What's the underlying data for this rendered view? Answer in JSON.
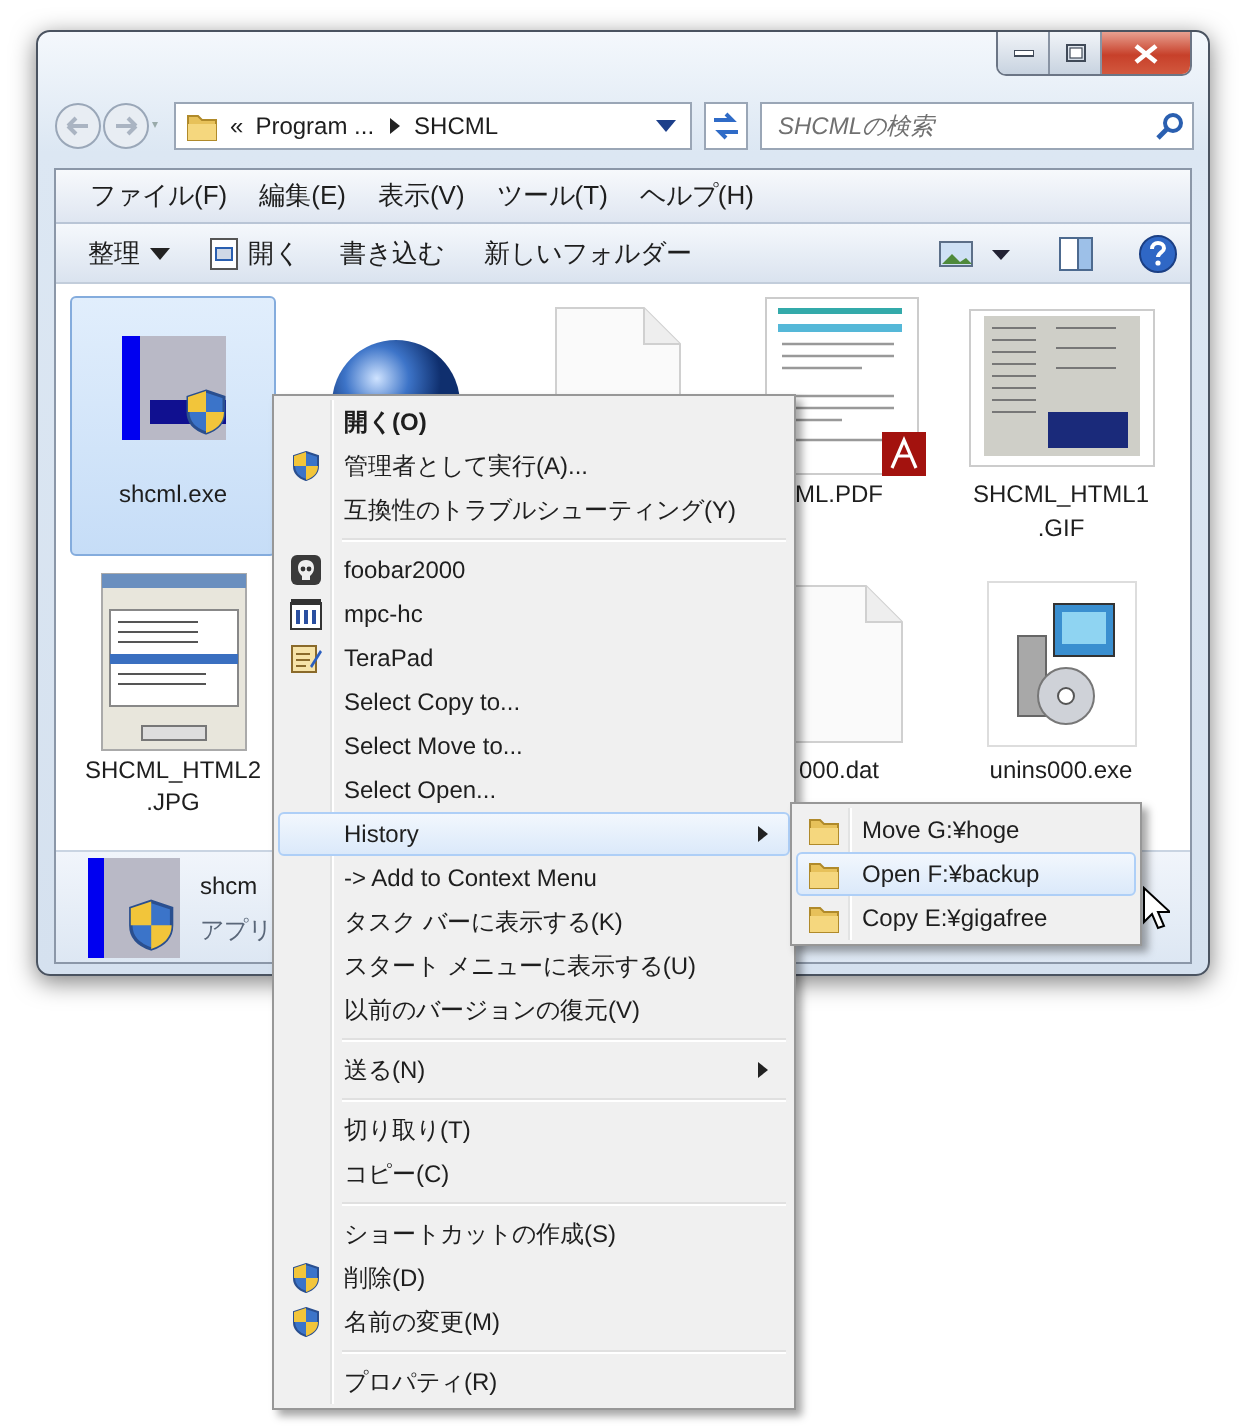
{
  "address_bar": {
    "overflow": "«",
    "path": [
      "Program ...",
      "SHCML"
    ]
  },
  "search": {
    "placeholder": "SHCMLの検索"
  },
  "menu_bar": [
    "ファイル(F)",
    "編集(E)",
    "表示(V)",
    "ツール(T)",
    "ヘルプ(H)"
  ],
  "toolbar": [
    {
      "label": "整理",
      "kind": "dropdown"
    },
    {
      "label": "開く",
      "kind": "open"
    },
    {
      "label": "書き込む",
      "kind": "plain"
    },
    {
      "label": "新しいフォルダー",
      "kind": "plain"
    }
  ],
  "files": [
    [
      {
        "lines": [
          "shcml.exe"
        ],
        "kind": "app",
        "selected": true
      },
      {
        "kind": "globe",
        "selected": false
      },
      {
        "kind": "page",
        "selected": false
      },
      {
        "lines": [
          "ML.PDF"
        ],
        "kind": "pdf",
        "selected": false
      },
      {
        "lines": [
          "SHCML_HTML1",
          ".GIF"
        ],
        "kind": "screenshot",
        "selected": false
      }
    ],
    [
      {
        "lines": [
          "SHCML_HTML2",
          ".JPG"
        ],
        "kind": "dialog",
        "selected": false
      },
      {
        "lines": [
          "000.dat"
        ],
        "kind": "page",
        "selected": false
      },
      {
        "lines": [
          "unins000.exe"
        ],
        "kind": "installer",
        "selected": false
      }
    ]
  ],
  "details": {
    "name": "shcm",
    "type": "アプリ"
  },
  "context_menu": [
    {
      "label": "開く(O)",
      "kind": "default",
      "selected": false
    },
    {
      "label": "管理者として実行(A)...",
      "kind": "shield",
      "selected": false
    },
    {
      "label": "互換性のトラブルシューティング(Y)",
      "kind": "plain",
      "selected": false
    },
    {
      "kind": "separator"
    },
    {
      "label": "foobar2000",
      "kind": "skull",
      "selected": false
    },
    {
      "label": "mpc-hc",
      "kind": "film",
      "selected": false
    },
    {
      "label": "TeraPad",
      "kind": "notepad",
      "selected": false
    },
    {
      "label": "Select Copy to...",
      "kind": "plain",
      "selected": false
    },
    {
      "label": "Select Move to...",
      "kind": "plain",
      "selected": false
    },
    {
      "label": "Select Open...",
      "kind": "plain",
      "selected": false
    },
    {
      "label": "History",
      "kind": "submenu",
      "selected": true
    },
    {
      "label": "-> Add to Context Menu",
      "kind": "plain",
      "selected": false
    },
    {
      "label": "タスク バーに表示する(K)",
      "kind": "plain",
      "selected": false
    },
    {
      "label": "スタート メニューに表示する(U)",
      "kind": "plain",
      "selected": false
    },
    {
      "label": "以前のバージョンの復元(V)",
      "kind": "plain",
      "selected": false
    },
    {
      "kind": "separator"
    },
    {
      "label": "送る(N)",
      "kind": "submenu",
      "selected": false
    },
    {
      "kind": "separator"
    },
    {
      "label": "切り取り(T)",
      "kind": "plain",
      "selected": false
    },
    {
      "label": "コピー(C)",
      "kind": "plain",
      "selected": false
    },
    {
      "kind": "separator"
    },
    {
      "label": "ショートカットの作成(S)",
      "kind": "plain",
      "selected": false
    },
    {
      "label": "削除(D)",
      "kind": "shield",
      "selected": false
    },
    {
      "label": "名前の変更(M)",
      "kind": "shield",
      "selected": false
    },
    {
      "kind": "separator"
    },
    {
      "label": "プロパティ(R)",
      "kind": "plain",
      "selected": false
    }
  ],
  "history_submenu": [
    {
      "label": "Move G:¥hoge",
      "selected": false
    },
    {
      "label": "Open F:¥backup",
      "selected": true
    },
    {
      "label": "Copy E:¥gigafree",
      "selected": false
    }
  ]
}
